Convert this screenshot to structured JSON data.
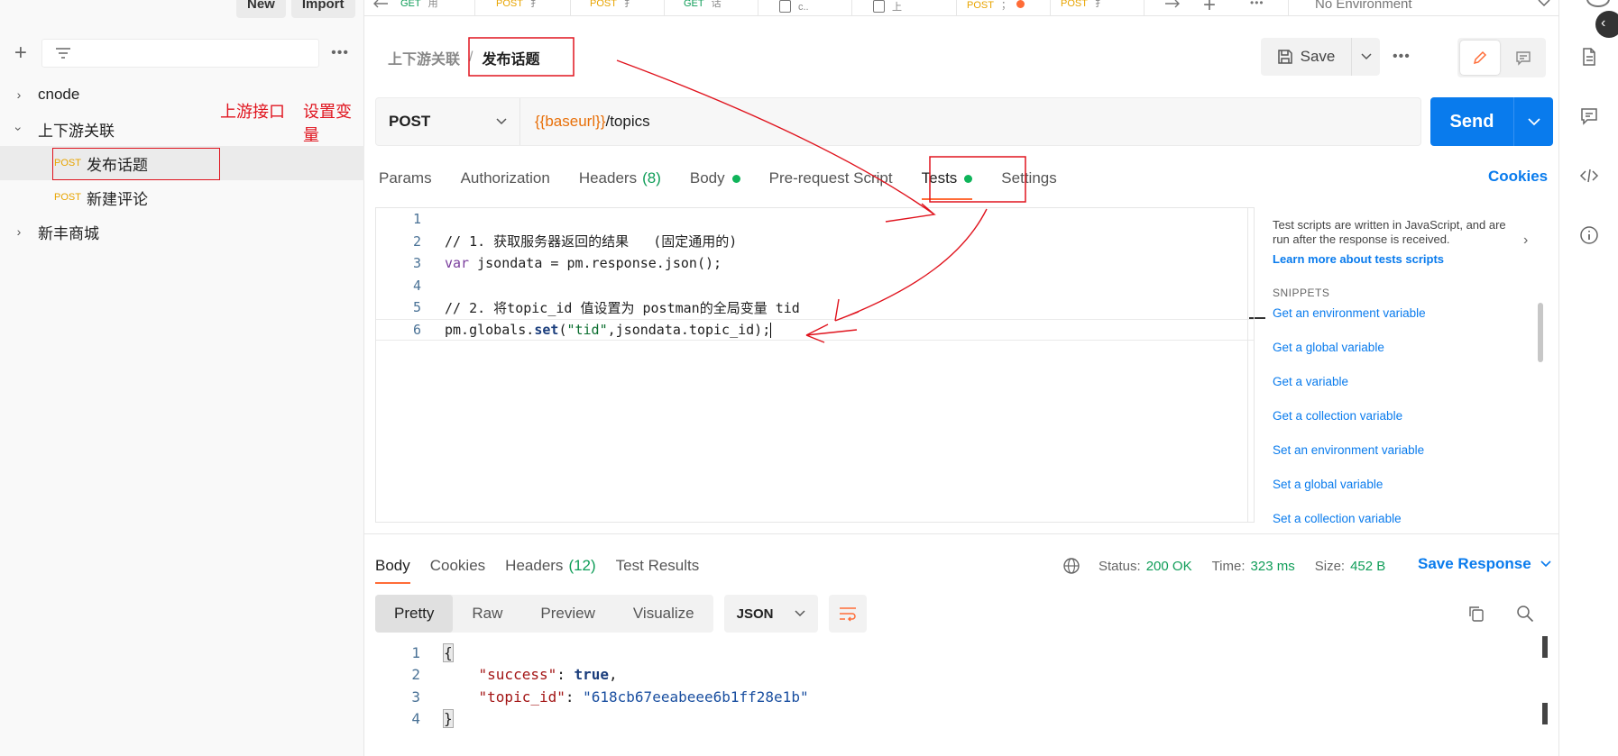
{
  "sidebar": {
    "new_label": "New",
    "import_label": "Import",
    "tree": [
      {
        "label": "cnode",
        "expanded": false
      },
      {
        "label": "上下游关联",
        "expanded": true
      },
      {
        "label": "发布话题",
        "method": "POST",
        "selected": true
      },
      {
        "label": "新建评论",
        "method": "POST"
      },
      {
        "label": "新丰商城",
        "expanded": false
      }
    ]
  },
  "tabs": [
    {
      "method": "GET",
      "label": "用"
    },
    {
      "method": "POST",
      "label": "扌"
    },
    {
      "method": "POST",
      "label": "扌"
    },
    {
      "method": "GET",
      "label": "话"
    },
    {
      "method": "",
      "label": "c.."
    },
    {
      "method": "",
      "label": "上"
    },
    {
      "method": "POST",
      "label": "；"
    },
    {
      "method": "POST",
      "label": "扌"
    }
  ],
  "environment": "No Environment",
  "breadcrumb": {
    "parent": "上下游关联",
    "sep": "/",
    "current": "发布话题"
  },
  "save_label": "Save",
  "request": {
    "method": "POST",
    "url_var": "{{baseurl}}",
    "url_path": "/topics",
    "send_label": "Send"
  },
  "request_tabs": {
    "params": "Params",
    "authorization": "Authorization",
    "headers": "Headers",
    "headers_count": "(8)",
    "body": "Body",
    "prerequest": "Pre-request Script",
    "tests": "Tests",
    "settings": "Settings",
    "cookies": "Cookies"
  },
  "test_script": {
    "line_numbers": [
      "1",
      "2",
      "3",
      "4",
      "5",
      "6"
    ],
    "line2": "// 1. 获取服务器返回的结果   (固定通用的)",
    "line3_kw": "var",
    "line3_rest": " jsondata = pm.response.json();",
    "line5": "// 2. 将topic_id 值设置为 postman的全局变量 tid",
    "line6_a": "pm.globals.",
    "line6_fn": "set",
    "line6_b": "(",
    "line6_str": "\"tid\"",
    "line6_c": ",jsondata.topic_id);"
  },
  "snippets_panel": {
    "description": "Test scripts are written in JavaScript, and are run after the response is received.",
    "learn_more": "Learn more about tests scripts",
    "title": "SNIPPETS",
    "items": [
      "Get an environment variable",
      "Get a global variable",
      "Get a variable",
      "Get a collection variable",
      "Set an environment variable",
      "Set a global variable",
      "Set a collection variable"
    ]
  },
  "response_tabs": {
    "body": "Body",
    "cookies": "Cookies",
    "headers": "Headers",
    "headers_count": "(12)",
    "test_results": "Test Results"
  },
  "response_meta": {
    "status_label": "Status:",
    "status_value": "200 OK",
    "time_label": "Time:",
    "time_value": "323 ms",
    "size_label": "Size:",
    "size_value": "452 B",
    "save_response": "Save Response"
  },
  "format": {
    "pretty": "Pretty",
    "raw": "Raw",
    "preview": "Preview",
    "visualize": "Visualize",
    "type": "JSON"
  },
  "response_body": {
    "line_numbers": [
      "1",
      "2",
      "3",
      "4"
    ],
    "open": "{",
    "k1": "\"success\"",
    "v1": "true",
    "k2": "\"topic_id\"",
    "v2": "\"618cb67eeabeee6b1ff28e1b\"",
    "close": "}"
  },
  "annotations": {
    "upstream_label": "上游接口",
    "set_var_label": "设置变量"
  },
  "colors": {
    "accent": "#ff6c37",
    "send": "#097bed",
    "annotation": "#e0141e",
    "status_ok": "#0f9d58"
  }
}
